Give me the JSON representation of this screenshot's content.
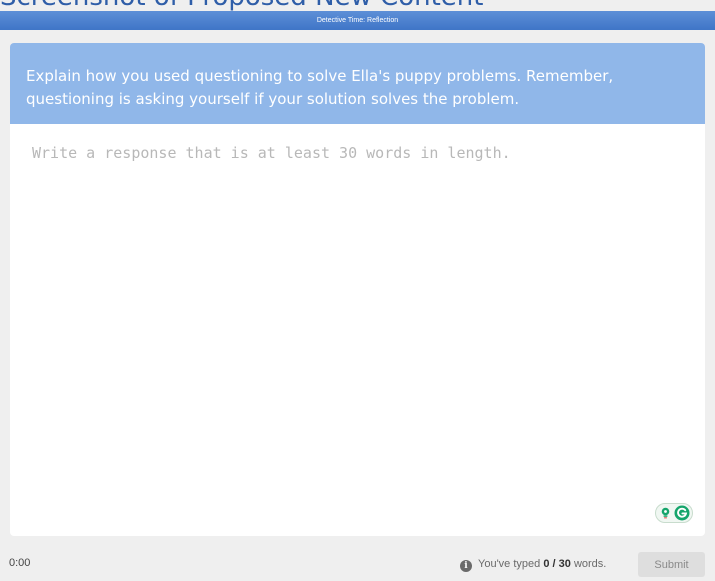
{
  "slide_title": "Screenshot of Proposed New Content",
  "activity_title": "Detective Time: Reflection",
  "prompt": "Explain how you used questioning to solve Ella's puppy problems. Remember, questioning is asking yourself if your solution solves the problem.",
  "response": {
    "placeholder": "Write a response that is at least 30 words in length.",
    "value": ""
  },
  "footer": {
    "timer": "0:00",
    "word_count_prefix": "You've typed",
    "words_typed": "0",
    "separator": "/",
    "words_required": "30",
    "word_count_suffix": "words.",
    "submit_label": "Submit"
  },
  "icons": {
    "info": "info-icon",
    "bulb": "lightbulb-icon",
    "grammar": "grammarly-icon"
  },
  "colors": {
    "header_bar": "#3f75c7",
    "prompt_band": "#90b7e9",
    "grammar_green": "#15a56b"
  }
}
